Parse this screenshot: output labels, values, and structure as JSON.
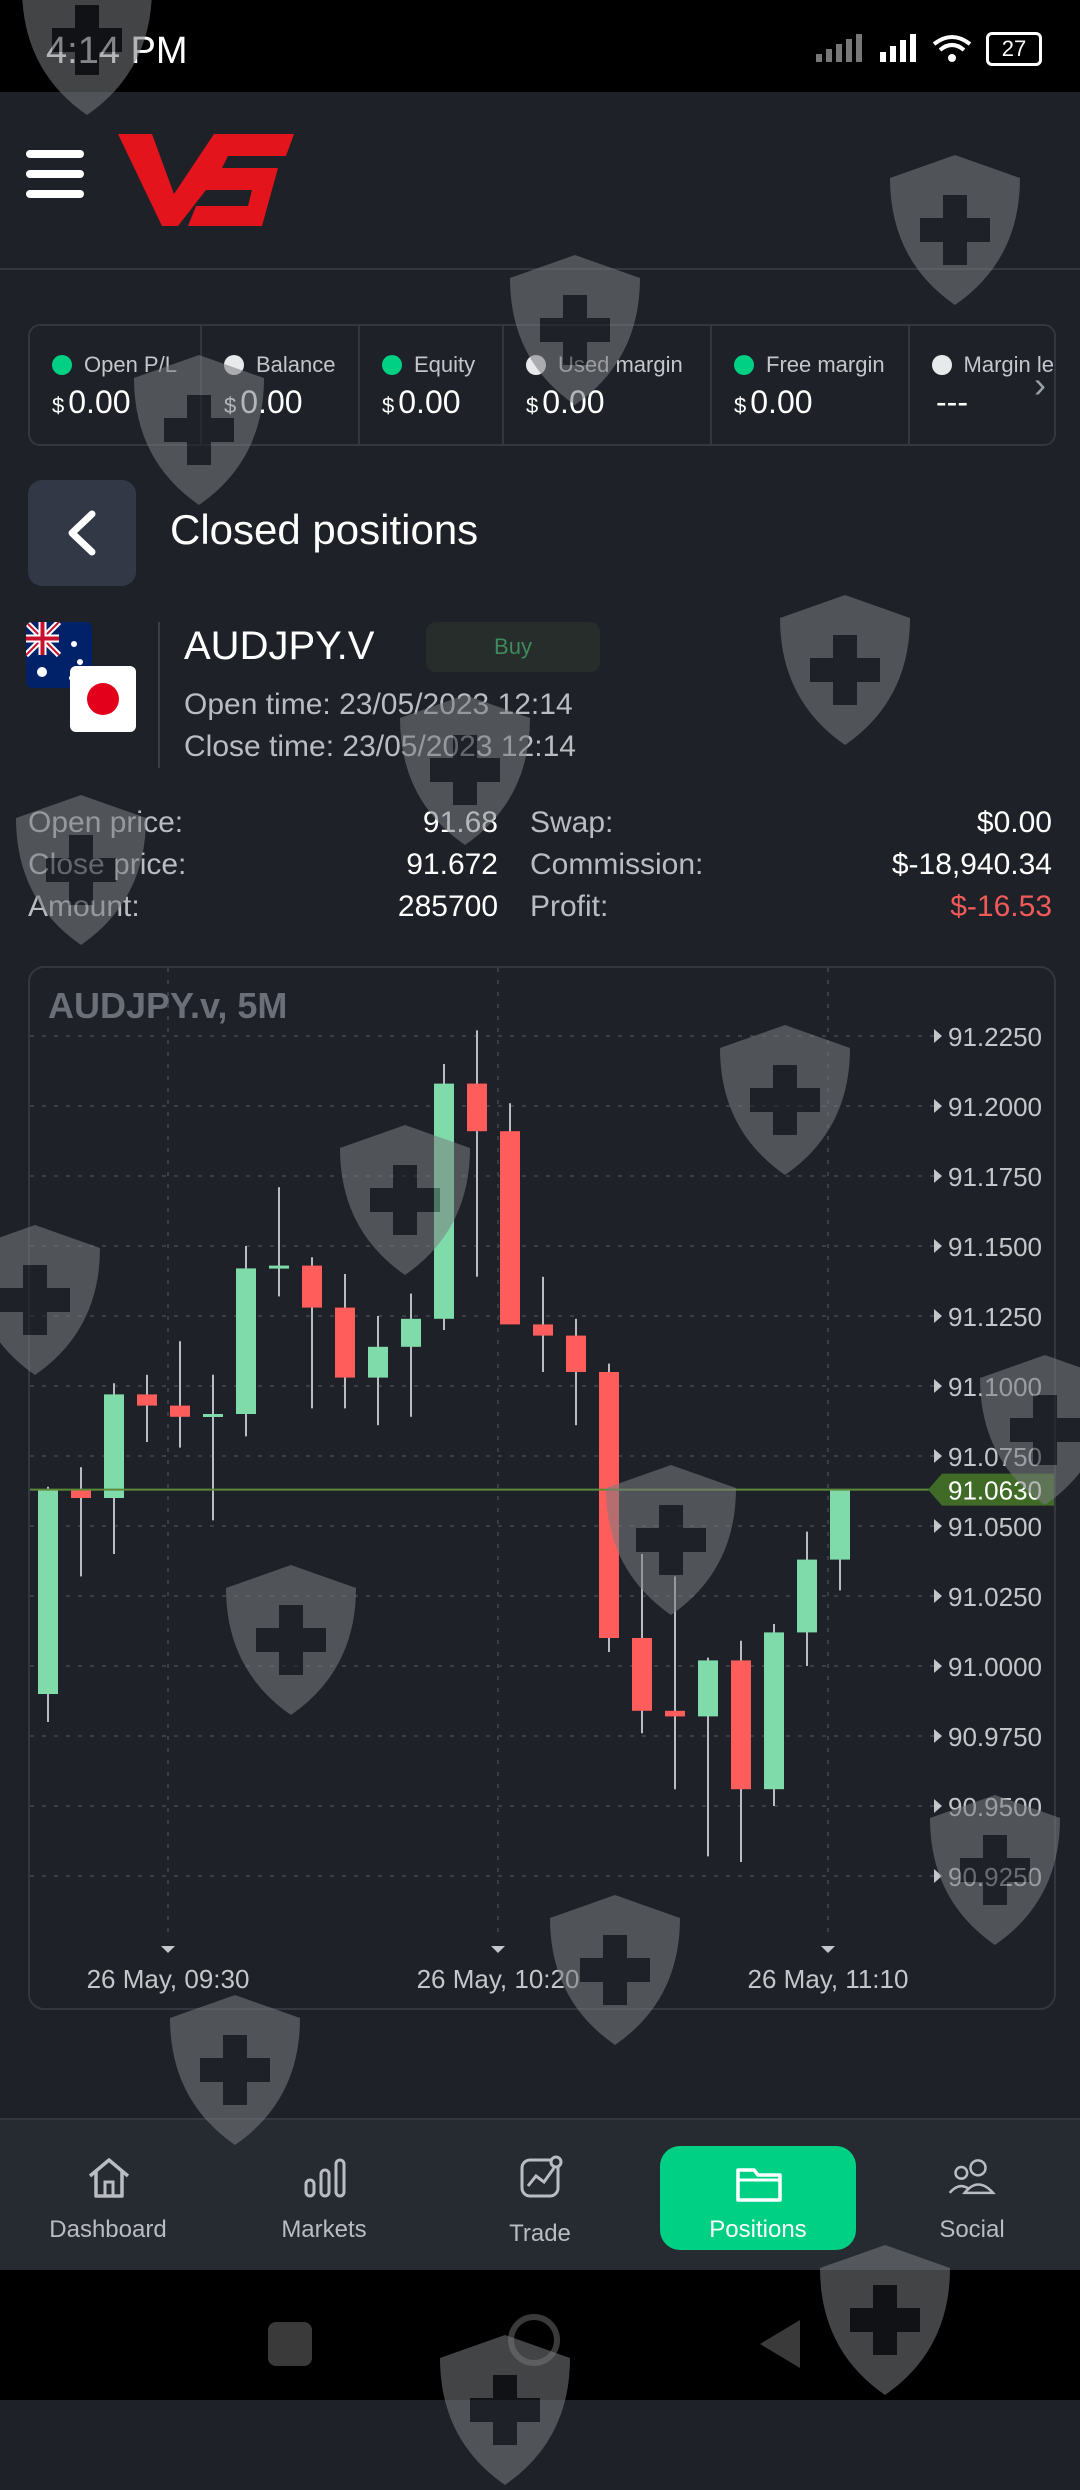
{
  "status": {
    "time": "4:14 PM",
    "battery": "27"
  },
  "stats": [
    {
      "label": "Open P/L",
      "currency": "$",
      "value": "0.00",
      "dot": "#00d084"
    },
    {
      "label": "Balance",
      "currency": "$",
      "value": "0.00",
      "dot": "#e8e9eb"
    },
    {
      "label": "Equity",
      "currency": "$",
      "value": "0.00",
      "dot": "#00d084"
    },
    {
      "label": "Used margin",
      "currency": "$",
      "value": "0.00",
      "dot": "#e8e9eb"
    },
    {
      "label": "Free margin",
      "currency": "$",
      "value": "0.00",
      "dot": "#00d084"
    },
    {
      "label": "Margin le",
      "currency": "",
      "value": "---",
      "dot": "#e8e9eb"
    }
  ],
  "page": {
    "title": "Closed positions"
  },
  "position": {
    "symbol": "AUDJPY.V",
    "side": "Buy",
    "open_time": "Open time: 23/05/2023 12:14",
    "close_time": "Close time: 23/05/2023 12:14",
    "open_price_label": "Open price:",
    "open_price": "91.68",
    "close_price_label": "Close price:",
    "close_price": "91.672",
    "amount_label": "Amount:",
    "amount": "285700",
    "swap_label": "Swap:",
    "swap": "$0.00",
    "commission_label": "Commission:",
    "commission": "$-18,940.34",
    "profit_label": "Profit:",
    "profit": "$-16.53"
  },
  "chart_data": {
    "type": "candlestick",
    "title": "AUDJPY.v, 5M",
    "y_ticks": [
      "91.2250",
      "91.2000",
      "91.1750",
      "91.1500",
      "91.1250",
      "91.1000",
      "91.0750",
      "91.0500",
      "91.0250",
      "91.0000",
      "90.9750",
      "90.9500",
      "90.9250"
    ],
    "ylim": [
      90.92,
      91.235
    ],
    "current_price": "91.0630",
    "x_labels": [
      "26 May, 09:30",
      "26 May, 10:20",
      "26 May, 11:10"
    ],
    "up_color": "#7fdcaa",
    "down_color": "#ff5c5c",
    "candles": [
      {
        "o": 90.99,
        "h": 91.064,
        "l": 90.98,
        "c": 91.063
      },
      {
        "o": 91.063,
        "h": 91.071,
        "l": 91.032,
        "c": 91.06
      },
      {
        "o": 91.06,
        "h": 91.101,
        "l": 91.04,
        "c": 91.097
      },
      {
        "o": 91.097,
        "h": 91.104,
        "l": 91.08,
        "c": 91.093
      },
      {
        "o": 91.093,
        "h": 91.116,
        "l": 91.078,
        "c": 91.089
      },
      {
        "o": 91.089,
        "h": 91.104,
        "l": 91.052,
        "c": 91.09
      },
      {
        "o": 91.09,
        "h": 91.15,
        "l": 91.082,
        "c": 91.142
      },
      {
        "o": 91.142,
        "h": 91.171,
        "l": 91.132,
        "c": 91.143
      },
      {
        "o": 91.143,
        "h": 91.146,
        "l": 91.092,
        "c": 91.128
      },
      {
        "o": 91.128,
        "h": 91.14,
        "l": 91.092,
        "c": 91.103
      },
      {
        "o": 91.103,
        "h": 91.125,
        "l": 91.086,
        "c": 91.114
      },
      {
        "o": 91.114,
        "h": 91.133,
        "l": 91.089,
        "c": 91.124
      },
      {
        "o": 91.124,
        "h": 91.215,
        "l": 91.12,
        "c": 91.208
      },
      {
        "o": 91.208,
        "h": 91.227,
        "l": 91.139,
        "c": 91.191
      },
      {
        "o": 91.191,
        "h": 91.201,
        "l": 91.14,
        "c": 91.122
      },
      {
        "o": 91.122,
        "h": 91.139,
        "l": 91.105,
        "c": 91.118
      },
      {
        "o": 91.118,
        "h": 91.124,
        "l": 91.086,
        "c": 91.105
      },
      {
        "o": 91.105,
        "h": 91.108,
        "l": 91.005,
        "c": 91.01
      },
      {
        "o": 91.01,
        "h": 91.04,
        "l": 90.976,
        "c": 90.984
      },
      {
        "o": 90.984,
        "h": 91.032,
        "l": 90.956,
        "c": 90.982
      },
      {
        "o": 90.982,
        "h": 91.003,
        "l": 90.932,
        "c": 91.002
      },
      {
        "o": 91.002,
        "h": 91.009,
        "l": 90.93,
        "c": 90.956
      },
      {
        "o": 90.956,
        "h": 91.015,
        "l": 90.95,
        "c": 91.012
      },
      {
        "o": 91.012,
        "h": 91.048,
        "l": 91.0,
        "c": 91.038
      },
      {
        "o": 91.038,
        "h": 91.063,
        "l": 91.027,
        "c": 91.063
      }
    ]
  },
  "nav": [
    {
      "label": "Dashboard",
      "icon": "home-icon"
    },
    {
      "label": "Markets",
      "icon": "markets-icon"
    },
    {
      "label": "Trade",
      "icon": "trade-icon"
    },
    {
      "label": "Positions",
      "icon": "folder-icon"
    },
    {
      "label": "Social",
      "icon": "social-icon"
    }
  ]
}
